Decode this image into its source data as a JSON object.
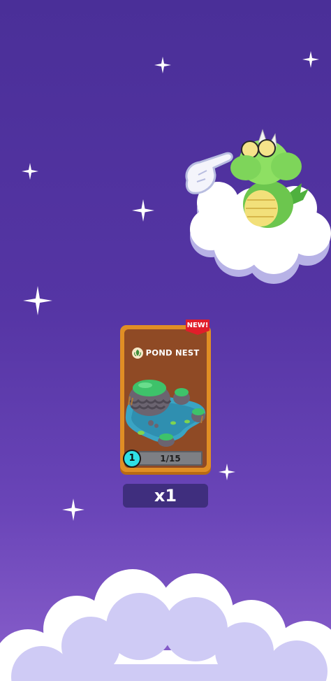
{
  "card": {
    "title": "POND NEST",
    "new_badge": "NEW!",
    "level": "1",
    "progress": "1/15",
    "progress_fraction": 0.0667,
    "icon": "nest-leaf-icon"
  },
  "reward": {
    "count": "x1"
  },
  "character": {
    "icon": "green-dragon-character"
  },
  "colors": {
    "background_top": "#4a2f98",
    "background_bottom": "#8a60cc",
    "card_frame": "#e08e24",
    "card_body": "#8f4a25",
    "level_badge": "#2fe0e6",
    "new_badge": "#e11d2a"
  }
}
